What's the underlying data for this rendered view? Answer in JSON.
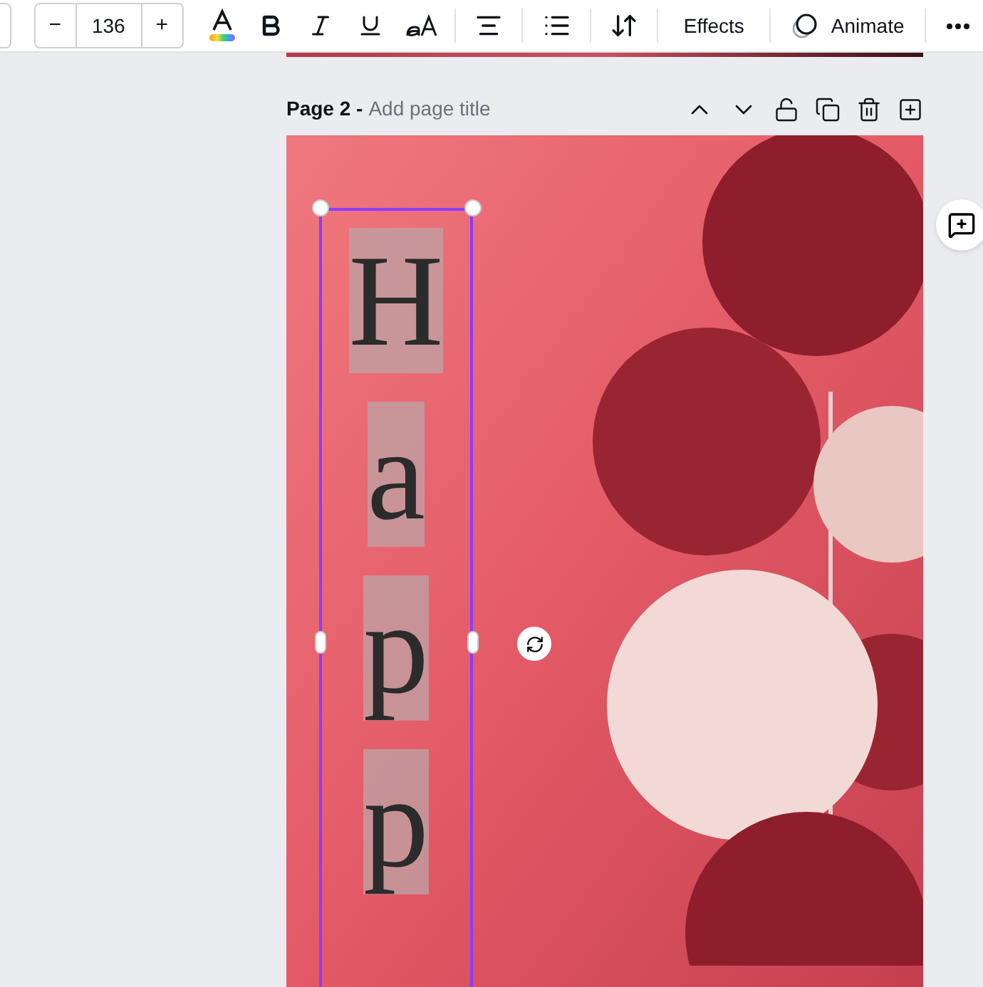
{
  "toolbar": {
    "font_size": "136",
    "decrease": "−",
    "increase": "+",
    "effects": "Effects",
    "animate": "Animate"
  },
  "page": {
    "label": "Page 2 -",
    "title_placeholder": "Add page title"
  },
  "design": {
    "text": "Happ"
  }
}
